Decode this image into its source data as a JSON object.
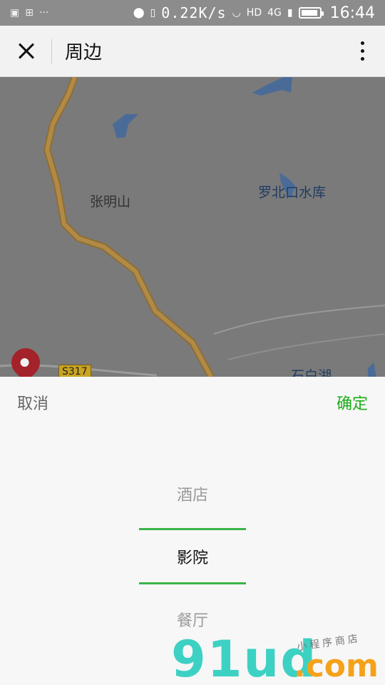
{
  "status_bar": {
    "left_icons": [
      "image-icon",
      "apps-icon",
      "more-dots-icon"
    ],
    "network_speed": "0.22K/s",
    "signal_label": "HD",
    "network_type": "4G",
    "time": "16:44"
  },
  "title_bar": {
    "title": "周边"
  },
  "map": {
    "labels": {
      "zhangming": "张明山",
      "luobei": "罗北口水库",
      "shibai": "石白湖"
    },
    "road_badge": "S317"
  },
  "picker": {
    "cancel": "取消",
    "confirm": "确定",
    "options": [
      "酒店",
      "影院",
      "餐厅"
    ],
    "selected": "影院"
  },
  "watermark": {
    "logo": "91ud",
    "domain": ".com",
    "tagline": "小程序商店"
  },
  "colors": {
    "accent_green": "#1aad19",
    "select_line": "#39b54a",
    "map_road": "#b08a46",
    "water": "#4a6b98"
  }
}
